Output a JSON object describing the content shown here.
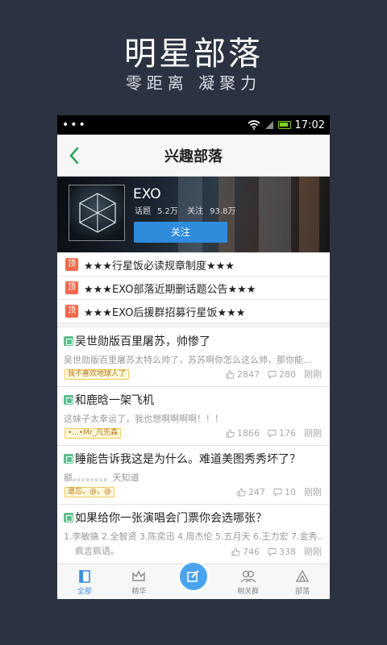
{
  "promo": {
    "title": "明星部落",
    "subtitle": "零距离  凝聚力"
  },
  "statusbar": {
    "dots": "•••",
    "time": "17:02"
  },
  "header": {
    "title": "兴趣部落"
  },
  "tribe": {
    "name": "EXO",
    "topics_label": "话题",
    "topics_value": "5.2万",
    "followers_label": "关注",
    "followers_value": "93.8万",
    "follow_label": "关注"
  },
  "pinned": [
    {
      "badge": "顶",
      "text": "★★★行星饭必读规章制度★★★"
    },
    {
      "badge": "顶",
      "text": "★★★EXO部落近期删话题公告★★★"
    },
    {
      "badge": "顶",
      "text": "★★★EXO后援群招募行星饭★★★"
    }
  ],
  "posts": [
    {
      "title": "吴世勋版百里屠苏，帅惨了",
      "body": "吴世勋版百里屠苏太特么帅了，苏苏啊你怎么这么帅，那你能...",
      "author": "我不喜欢地球人了",
      "likes": "2847",
      "comments": "280",
      "time": "刚刚"
    },
    {
      "title": "和鹿晗一架飞机",
      "body": "这妹子太幸运了，我也想啊啊啊啊！！！",
      "author": "•...•Mr_凡先森",
      "likes": "1866",
      "comments": "176",
      "time": "刚刚"
    },
    {
      "title": "睡能告诉我这是为什么。难道美图秀秀坏了？",
      "body": "额。。。。。。。。天知道",
      "author": "遗忘，@，@",
      "likes": "247",
      "comments": "10",
      "time": "刚刚"
    },
    {
      "title": "如果给你一张演唱会门票你会选哪张？",
      "body": "1.李敏镐 2.全智贤 3.陈奕迅 4.周杰伦 5.五月天 6.王力宏 7.金秀...",
      "author": "疯言疯语。",
      "likes": "746",
      "comments": "338",
      "time": "刚刚"
    }
  ],
  "tabs": [
    {
      "label": "全部",
      "icon": "book-icon"
    },
    {
      "label": "精华",
      "icon": "crown-icon"
    },
    {
      "label": "",
      "icon": "compose-icon"
    },
    {
      "label": "相关群",
      "icon": "group-icon"
    },
    {
      "label": "部落",
      "icon": "tribe-icon"
    }
  ],
  "colors": {
    "accent": "#2f8bdc",
    "pin": "#ef6a4a",
    "tag": "#5fbf8e",
    "background": "#2b3241"
  }
}
